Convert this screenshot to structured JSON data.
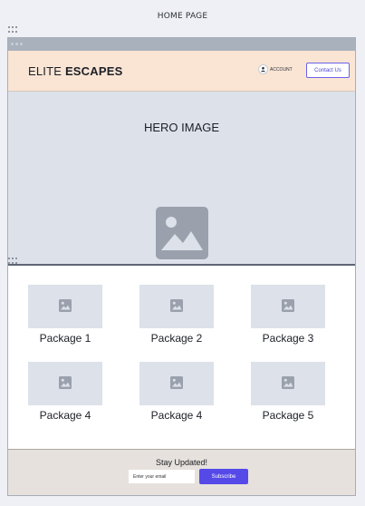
{
  "page": {
    "title": "HOME PAGE"
  },
  "navbar": {
    "brand_light": "ELITE ",
    "brand_bold": "ESCAPES",
    "account_label": "ACCOUNT",
    "contact_label": "Contact Us"
  },
  "hero": {
    "label": "HERO IMAGE",
    "icon": "image-icon"
  },
  "packages": {
    "items": [
      {
        "label": "Package 1",
        "icon": "image-icon"
      },
      {
        "label": "Package 2",
        "icon": "image-icon"
      },
      {
        "label": "Package 3",
        "icon": "image-icon"
      },
      {
        "label": "Package 4",
        "icon": "image-icon"
      },
      {
        "label": "Package 4",
        "icon": "image-icon"
      },
      {
        "label": "Package 5",
        "icon": "image-icon"
      }
    ]
  },
  "footer": {
    "title": "Stay Updated!",
    "email_placeholder": "Enter your email",
    "subscribe_label": "Subscribe"
  },
  "colors": {
    "navbar_bg": "#fae5d4",
    "hero_bg": "#dde1ea",
    "accent": "#5549e8",
    "footer_bg": "#e6e1dc",
    "image_placeholder": "#9aa1ad"
  }
}
